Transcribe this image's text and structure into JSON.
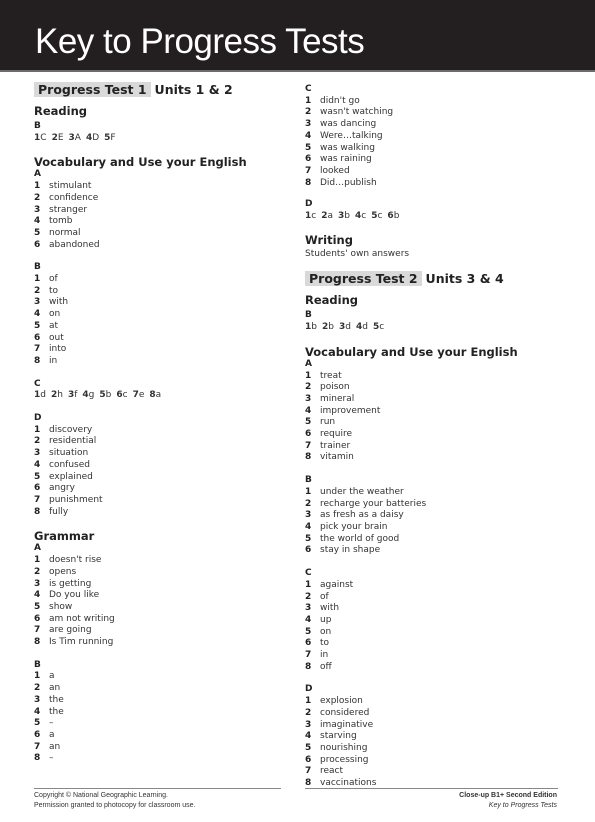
{
  "header": {
    "title": "Key to Progress Tests"
  },
  "test1": {
    "box_label": "Progress Test 1",
    "units": "Units 1 & 2",
    "reading": {
      "title": "Reading",
      "part": "B",
      "answers": [
        "1C",
        "2E",
        "3A",
        "4D",
        "5F"
      ]
    },
    "vocab": {
      "title": "Vocabulary and Use your English",
      "A": {
        "label": "A",
        "items": [
          "stimulant",
          "confidence",
          "stranger",
          "tomb",
          "normal",
          "abandoned"
        ]
      },
      "B": {
        "label": "B",
        "items": [
          "of",
          "to",
          "with",
          "on",
          "at",
          "out",
          "into",
          "in"
        ]
      },
      "C": {
        "label": "C",
        "answers": [
          "1d",
          "2h",
          "3f",
          "4g",
          "5b",
          "6c",
          "7e",
          "8a"
        ]
      },
      "D": {
        "label": "D",
        "items": [
          "discovery",
          "residential",
          "situation",
          "confused",
          "explained",
          "angry",
          "punishment",
          "fully"
        ]
      }
    },
    "grammar": {
      "title": "Grammar",
      "A": {
        "label": "A",
        "items": [
          "doesn't rise",
          "opens",
          "is getting",
          "Do you like",
          "show",
          "am not writing",
          "are going",
          "Is Tim running"
        ]
      },
      "B": {
        "label": "B",
        "items": [
          "a",
          "an",
          "the",
          "the",
          "–",
          "a",
          "an",
          "–"
        ]
      },
      "C": {
        "label": "C",
        "items": [
          "didn't go",
          "wasn't watching",
          "was dancing",
          "Were…talking",
          "was walking",
          "was raining",
          "looked",
          "Did…publish"
        ]
      },
      "D": {
        "label": "D",
        "answers": [
          "1c",
          "2a",
          "3b",
          "4c",
          "5c",
          "6b"
        ]
      }
    },
    "writing": {
      "title": "Writing",
      "text": "Students' own answers"
    }
  },
  "test2": {
    "box_label": "Progress Test 2",
    "units": "Units 3 & 4",
    "reading": {
      "title": "Reading",
      "part": "B",
      "answers": [
        "1b",
        "2b",
        "3d",
        "4d",
        "5c"
      ]
    },
    "vocab": {
      "title": "Vocabulary and Use your English",
      "A": {
        "label": "A",
        "items": [
          "treat",
          "poison",
          "mineral",
          "improvement",
          "run",
          "require",
          "trainer",
          "vitamin"
        ]
      },
      "B": {
        "label": "B",
        "items": [
          "under the weather",
          "recharge your batteries",
          "as fresh as a daisy",
          "pick your brain",
          "the world of good",
          "stay in shape"
        ]
      },
      "C": {
        "label": "C",
        "items": [
          "against",
          "of",
          "with",
          "up",
          "on",
          "to",
          "in",
          "off"
        ]
      },
      "D": {
        "label": "D",
        "items": [
          "explosion",
          "considered",
          "imaginative",
          "starving",
          "nourishing",
          "processing",
          "react",
          "vaccinations"
        ]
      }
    }
  },
  "footer": {
    "copyright": "Copyright © National Geographic Learning.",
    "permission": "Permission granted to photocopy for classroom use.",
    "edition": "Close-up B1+ Second Edition",
    "subtitle": "Key to Progress Tests"
  }
}
